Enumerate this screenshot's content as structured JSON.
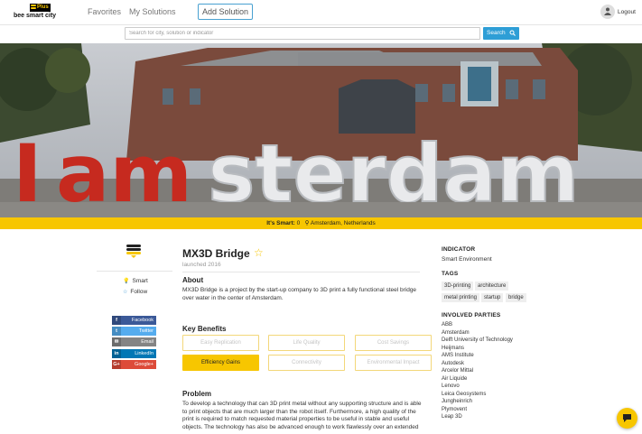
{
  "brand": {
    "badge": "Plus",
    "name": "bee smart city"
  },
  "nav": {
    "favorites": "Favorites",
    "my_solutions": "My Solutions",
    "add_solution": "Add Solution",
    "logout": "Logout"
  },
  "search": {
    "placeholder": "Search for city, solution or indicator",
    "button_label": "Search"
  },
  "hero": {
    "image": "I amsterdam letters photo",
    "its_smart_label": "It's Smart:",
    "its_smart_count": "0",
    "location": "Amsterdam, Netherlands"
  },
  "sidebar": {
    "smart_label": "Smart",
    "follow_label": "Follow",
    "share": [
      {
        "icon": "facebook-icon",
        "glyph": "f",
        "label": "Facebook",
        "color": "#3b5998"
      },
      {
        "icon": "twitter-icon",
        "glyph": "t",
        "label": "Twitter",
        "color": "#55acee"
      },
      {
        "icon": "email-icon",
        "glyph": "✉",
        "label": "Email",
        "color": "#848484"
      },
      {
        "icon": "linkedin-icon",
        "glyph": "in",
        "label": "LinkedIn",
        "color": "#0077b5"
      },
      {
        "icon": "googleplus-icon",
        "glyph": "G+",
        "label": "Google+",
        "color": "#dd4b39"
      }
    ]
  },
  "solution": {
    "title": "MX3D Bridge",
    "launched": "launched 2016",
    "about_heading": "About",
    "about_text": "MX3D Bridge is a project by the start-up company to 3D print a fully functional steel bridge over water in the center of Amsterdam.",
    "benefits_heading": "Key Benefits",
    "benefits": [
      {
        "label": "Easy Replication",
        "active": false
      },
      {
        "label": "Life Quality",
        "active": false
      },
      {
        "label": "Cost Savings",
        "active": false
      },
      {
        "label": "Efficiency Gains",
        "active": true
      },
      {
        "label": "Connectivity",
        "active": false
      },
      {
        "label": "Environmental Impact",
        "active": false
      }
    ],
    "problem_heading": "Problem",
    "problem_text": "To develop a technology that can 3D print metal without any supporting structure and is able to print objects that are much larger than the robot itself. Furthermore, a high quality of the print is required to match requested material properties to be useful in stable and useful objects. The technology has also be advanced enough to work flawlessly over an extended"
  },
  "right": {
    "indicator_heading": "INDICATOR",
    "indicator_value": "Smart Environment",
    "tags_heading": "TAGS",
    "tags": [
      "3D-printing",
      "architecture",
      "metal printing",
      "startup",
      "bridge"
    ],
    "parties_heading": "INVOLVED PARTIES",
    "parties": [
      "ABB",
      "Amsterdam",
      "Delft University of Technology",
      "Heijmans",
      "AMS Institute",
      "Autodesk",
      "Arcelor Mittal",
      "Air Liquide",
      "Lenovo",
      "Leica Geosystems",
      "Jungheinrich",
      "Plymovent",
      "Leap 3D"
    ]
  }
}
